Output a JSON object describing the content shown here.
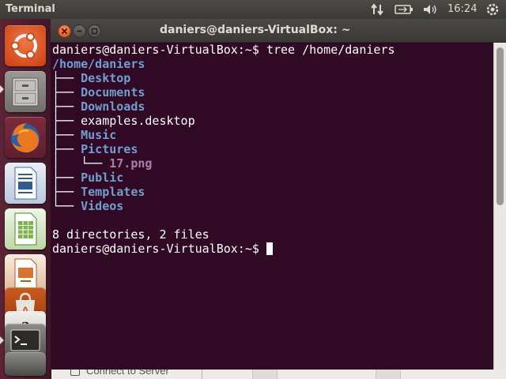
{
  "panel": {
    "app_name": "Terminal",
    "clock": "16:24",
    "indicators": [
      "network-transfer-icon",
      "battery-icon",
      "volume-icon",
      "power-gear-icon"
    ]
  },
  "launcher": {
    "items": [
      {
        "name": "dash-home",
        "icon": "ubuntu-logo-icon"
      },
      {
        "name": "files",
        "icon": "file-cabinet-icon"
      },
      {
        "name": "firefox",
        "icon": "firefox-icon"
      },
      {
        "name": "writer",
        "icon": "libreoffice-writer-icon"
      },
      {
        "name": "calc",
        "icon": "libreoffice-calc-icon"
      },
      {
        "name": "impress",
        "icon": "libreoffice-impress-icon"
      },
      {
        "name": "software-center",
        "icon": "shopping-bag-icon"
      },
      {
        "name": "amazon",
        "icon": "amazon-icon"
      },
      {
        "name": "terminal",
        "icon": "terminal-icon"
      }
    ],
    "colors": {
      "accent": "#dd4814",
      "background": "#5b2436"
    }
  },
  "window": {
    "title": "daniers@daniers-VirtualBox: ~",
    "buttons": [
      "close",
      "minimize",
      "maximize"
    ]
  },
  "terminal": {
    "prompt": "daniers@daniers-VirtualBox:~$ ",
    "command": "tree /home/daniers",
    "root": "/home/daniers",
    "tree": [
      {
        "branch": "├── ",
        "name": "Desktop",
        "type": "dir"
      },
      {
        "branch": "├── ",
        "name": "Documents",
        "type": "dir"
      },
      {
        "branch": "├── ",
        "name": "Downloads",
        "type": "dir"
      },
      {
        "branch": "├── ",
        "name": "examples.desktop",
        "type": "file"
      },
      {
        "branch": "├── ",
        "name": "Music",
        "type": "dir"
      },
      {
        "branch": "├── ",
        "name": "Pictures",
        "type": "dir"
      },
      {
        "branch": "│   └── ",
        "name": "17.png",
        "type": "image"
      },
      {
        "branch": "├── ",
        "name": "Public",
        "type": "dir"
      },
      {
        "branch": "├── ",
        "name": "Templates",
        "type": "dir"
      },
      {
        "branch": "└── ",
        "name": "Videos",
        "type": "dir"
      }
    ],
    "summary": "8 directories, 2 files",
    "final_prompt": "daniers@daniers-VirtualBox:~$",
    "colors": {
      "background": "#300a24",
      "text": "#ffffff",
      "directory": "#729fcf",
      "image": "#ad7fa8"
    }
  },
  "background_window": {
    "text": "Connect to Server"
  }
}
